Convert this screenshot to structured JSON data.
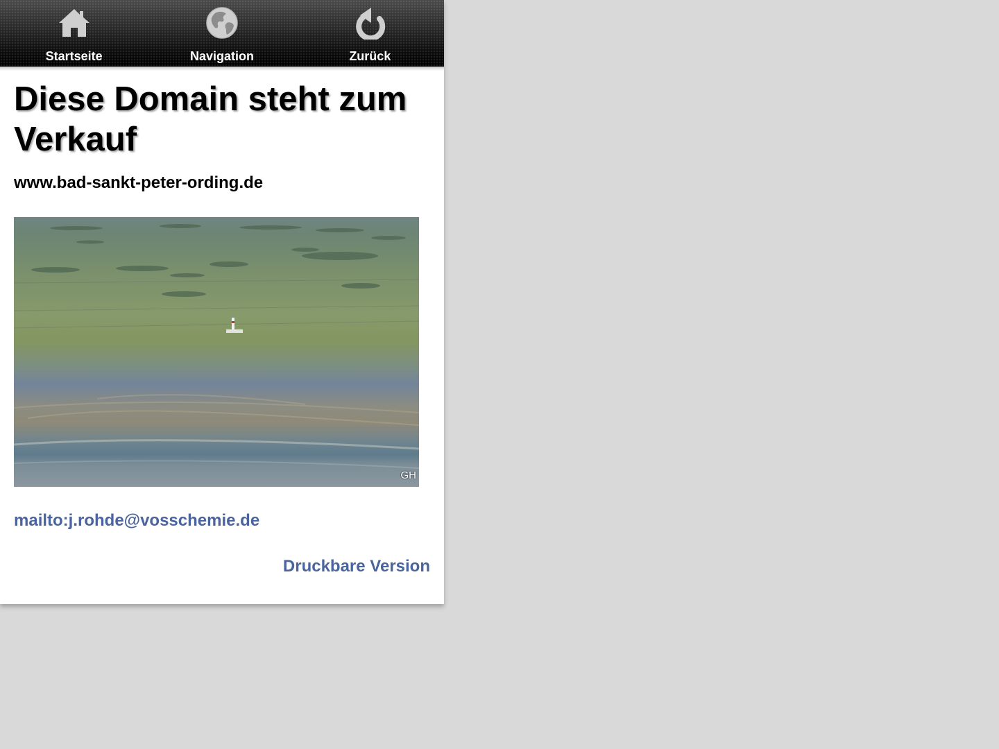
{
  "nav": {
    "items": [
      {
        "label": "Startseite",
        "icon": "home-icon"
      },
      {
        "label": "Navigation",
        "icon": "globe-icon"
      },
      {
        "label": "Zurück",
        "icon": "back-arrow-icon"
      }
    ]
  },
  "main": {
    "title": "Diese Domain steht zum Verkauf",
    "domain": "www.bad-sankt-peter-ording.de",
    "photo_credit": "GH",
    "mail_link": "mailto:j.rohde@vosschemie.de",
    "print_link": "Druckbare Version"
  },
  "colors": {
    "link": "#4a64a0",
    "page_background": "#d9d9d9",
    "topbar": "#1a1a1a"
  }
}
